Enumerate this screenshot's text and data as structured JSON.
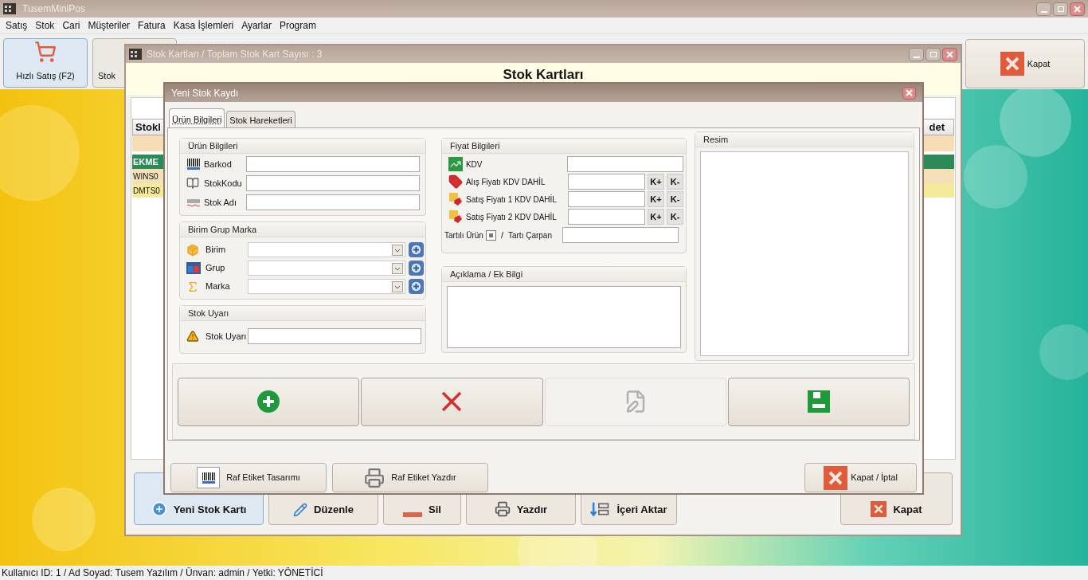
{
  "app": {
    "title": "TusemMiniPos"
  },
  "menu": [
    "Satış",
    "Stok",
    "Cari",
    "Müşteriler",
    "Fatura",
    "Kasa İşlemleri",
    "Ayarlar",
    "Program"
  ],
  "toolbar": [
    {
      "label": "Hızlı Satış (F2)",
      "kind": "cart",
      "selected": true
    },
    {
      "label": "Stok",
      "kind": "partial",
      "selected": false
    }
  ],
  "close_button": {
    "label": "Kapat"
  },
  "stock_window": {
    "title": "Stok Kartları / Toplam Stok Kart Sayısı : 3",
    "heading": "Stok Kartları",
    "table": {
      "columns": [
        "Stokl",
        "det"
      ],
      "rows": [
        {
          "code": "EKME",
          "color": "#2b8a57"
        },
        {
          "code": "WINS0",
          "color": "#f5dfb8"
        },
        {
          "code": "DMTS0",
          "color": "#f3ea9c"
        }
      ]
    },
    "buttons": [
      {
        "label": "Yeni Stok Kartı",
        "kind": "add",
        "selected": true
      },
      {
        "label": "Düzenle",
        "kind": "edit",
        "selected": false
      },
      {
        "label": "Sil",
        "kind": "delete",
        "selected": false
      },
      {
        "label": "Yazdır",
        "kind": "print",
        "selected": false
      },
      {
        "label": "İçeri Aktar",
        "kind": "import",
        "selected": false
      },
      {
        "label": "Kapat",
        "kind": "close",
        "selected": false
      }
    ]
  },
  "dialog": {
    "title": "Yeni Stok Kaydı",
    "tabs": [
      {
        "label": "Ürün Bilgileri",
        "selected": true
      },
      {
        "label": "Stok Hareketleri",
        "selected": false
      }
    ],
    "product_group": {
      "title": "Ürün Bilgileri",
      "fields": [
        {
          "label": "Barkod",
          "kind": "barcode"
        },
        {
          "label": "StokKodu",
          "kind": "code"
        },
        {
          "label": "Stok Adı",
          "kind": "name"
        }
      ]
    },
    "unit_group": {
      "title": "Birim Grup Marka",
      "fields": [
        {
          "label": "Birim",
          "kind": "unit"
        },
        {
          "label": "Grup",
          "kind": "group"
        },
        {
          "label": "Marka",
          "kind": "brand"
        }
      ]
    },
    "warning_group": {
      "title": "Stok Uyarı",
      "field": {
        "label": "Stok Uyarı"
      }
    },
    "price_group": {
      "title": "Fiyat Bilgileri",
      "fields": [
        {
          "label": "KDV",
          "kind": "tax"
        },
        {
          "label": "Alış Fiyatı KDV DAHİL",
          "kind": "buy",
          "buttons": [
            "K+",
            "K-"
          ]
        },
        {
          "label": "Satış Fiyatı 1 KDV DAHİL",
          "kind": "sell",
          "buttons": [
            "K+",
            "K-"
          ]
        },
        {
          "label": "Satış Fiyatı 2 KDV DAHİL",
          "kind": "sell",
          "buttons": [
            "K+",
            "K-"
          ]
        }
      ],
      "weighed": {
        "label": "Tartılı Ürün",
        "checked": true,
        "separator": "/",
        "multiplier_label": "Tartı Çarpan"
      }
    },
    "note_group": {
      "title": "Açıklama / Ek Bilgi"
    },
    "image_group": {
      "title": "Resim"
    },
    "actions": [
      {
        "kind": "add",
        "disabled": false
      },
      {
        "kind": "delete",
        "disabled": false
      },
      {
        "kind": "edit",
        "disabled": true
      },
      {
        "kind": "save",
        "disabled": false
      }
    ],
    "footer": [
      {
        "label": "Raf Etiket Tasarımı",
        "kind": "barcode"
      },
      {
        "label": "Raf Etiket Yazdır",
        "kind": "print"
      }
    ],
    "cancel": {
      "label": "Kapat / İptal"
    }
  },
  "status_bar": "Kullanıcı ID: 1 / Ad Soyad: Tusem Yazılım / Ünvan: admin / Yetki: YÖNETİCİ"
}
